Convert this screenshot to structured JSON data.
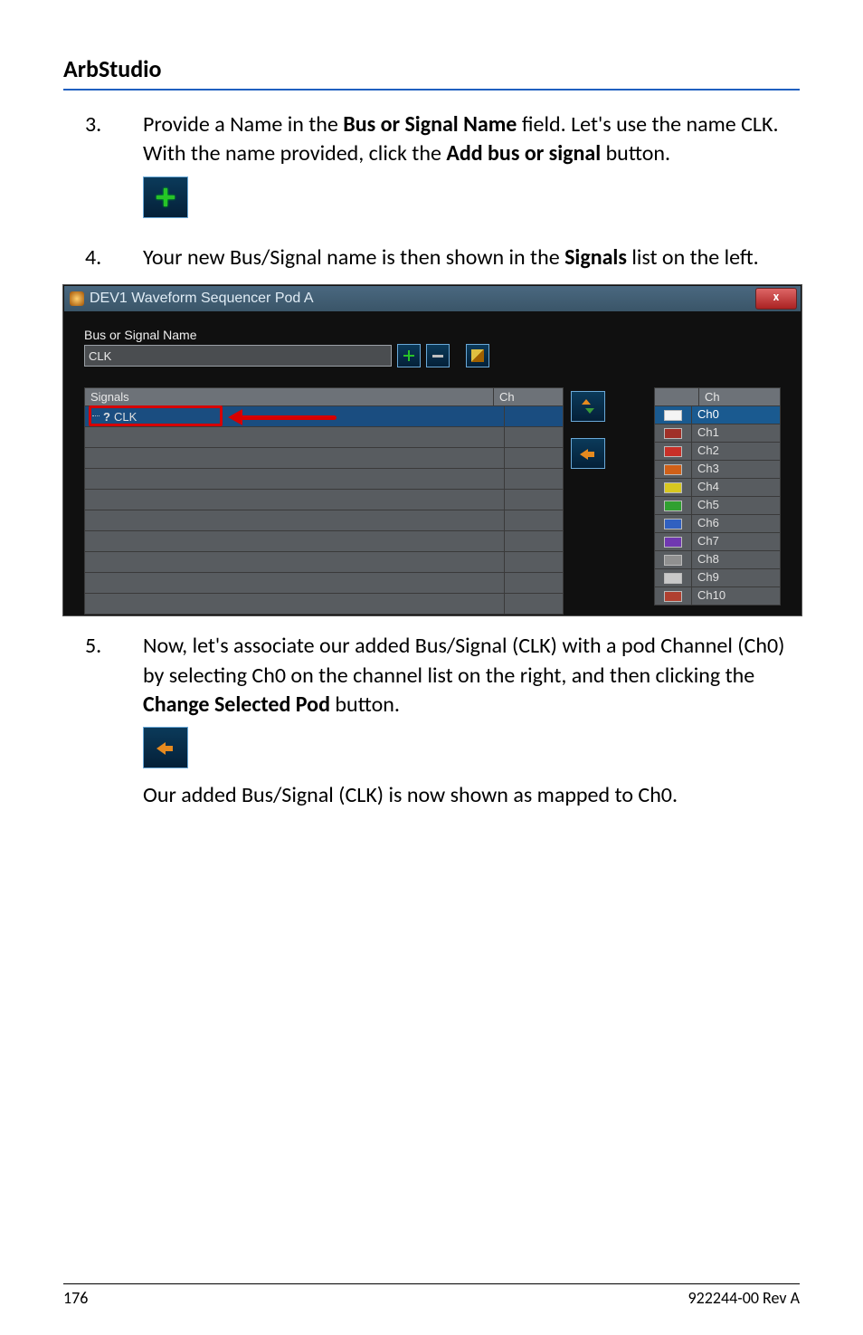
{
  "doc": {
    "header": "ArbStudio",
    "step3": {
      "num": "3.",
      "t1": "Provide a Name in the ",
      "b1": "Bus or Signal Name",
      "t2": " field. Let's use the name CLK. With the name provided, click the ",
      "b2": "Add bus or signal",
      "t3": " button."
    },
    "step4": {
      "num": "4.",
      "t1": "Your new Bus/Signal name is then shown in the ",
      "b1": "Signals",
      "t2": " list on the left."
    },
    "step5": {
      "num": "5.",
      "t1": "Now, let's associate our added Bus/Signal (CLK) with a pod Channel (Ch0) by selecting Ch0 on the channel list on the right, and then clicking the ",
      "b1": "Change Selected Pod",
      "t2": " button.",
      "after": "Our added Bus/Signal (CLK) is now shown as mapped to Ch0."
    },
    "footer_left": "176",
    "footer_right": "922244-00 Rev A"
  },
  "win": {
    "title": "DEV1 Waveform Sequencer Pod A",
    "close": "x",
    "label": "Bus or Signal Name",
    "input_value": "CLK",
    "left_headers": {
      "sig": "Signals",
      "ch": "Ch"
    },
    "clk_row_q": "?",
    "clk_row_label": "CLK",
    "right_header": "Ch",
    "channels": [
      {
        "name": "Ch0",
        "color": "#f4f4f4",
        "selected": true
      },
      {
        "name": "Ch1",
        "color": "#a03028"
      },
      {
        "name": "Ch2",
        "color": "#c83028"
      },
      {
        "name": "Ch3",
        "color": "#d06018"
      },
      {
        "name": "Ch4",
        "color": "#d8c820"
      },
      {
        "name": "Ch5",
        "color": "#30a030"
      },
      {
        "name": "Ch6",
        "color": "#3060c0"
      },
      {
        "name": "Ch7",
        "color": "#7038b0"
      },
      {
        "name": "Ch8",
        "color": "#909090"
      },
      {
        "name": "Ch9",
        "color": "#c8c8c8"
      },
      {
        "name": "Ch10",
        "color": "#b04030"
      }
    ]
  }
}
